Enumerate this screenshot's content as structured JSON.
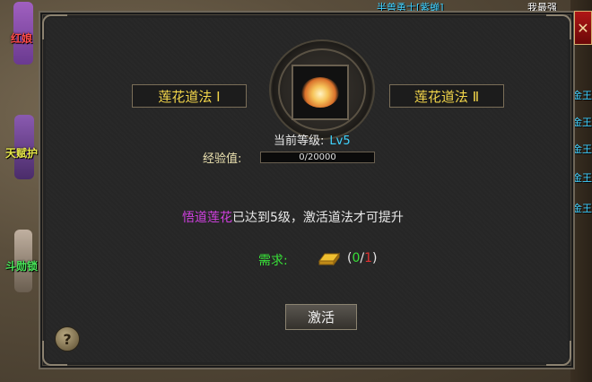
{
  "background": {
    "top_names": [
      "半兽勇士[紫蝉]",
      "我最强"
    ],
    "npcs": [
      {
        "name": "红娘",
        "color": "#ff4a4a"
      },
      {
        "name": "天赋护",
        "color": "#e8e84a"
      },
      {
        "name": "斗勋锁",
        "color": "#4ae85a"
      }
    ],
    "side_tags": [
      "金王",
      "金王",
      "金王",
      "金王",
      "金王"
    ]
  },
  "panel": {
    "close_label": "✕",
    "tabs": {
      "left": "莲花道法 Ⅰ",
      "right": "莲花道法 Ⅱ"
    },
    "item": {
      "name": "lotus-icon"
    },
    "level": {
      "label": "当前等级:",
      "value": "Lv5"
    },
    "experience": {
      "label": "经验值:",
      "text": "0/20000",
      "current": 0,
      "max": 20000
    },
    "message": {
      "highlight": "悟道莲花",
      "rest": "已达到5级，激活道法才可提升"
    },
    "requirement": {
      "label": "需求:",
      "item_icon": "gold-ingot-icon",
      "open": "(",
      "have": "0",
      "sep": "/",
      "need": "1",
      "close": ")"
    },
    "activate_label": "激活",
    "help_label": "?"
  },
  "colors": {
    "tab_text": "#f2d54a",
    "level_value": "#3fd4ff",
    "highlight": "#d040e0",
    "requirement_label": "#38e038",
    "need_count": "#e03030",
    "close_bg": "#b01616"
  }
}
